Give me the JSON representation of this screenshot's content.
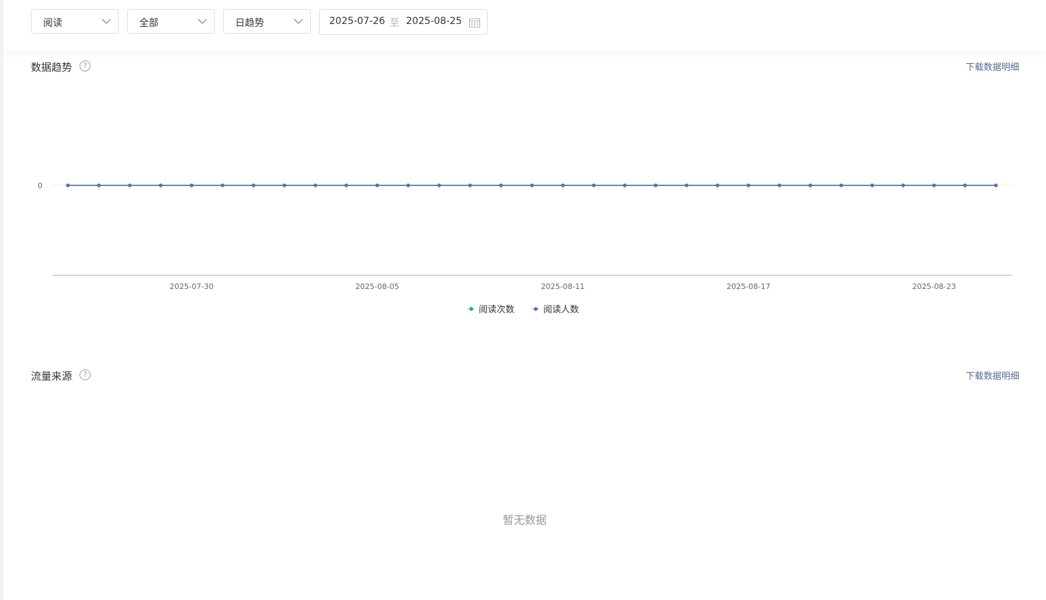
{
  "filters": {
    "type_select": "阅读",
    "scope_select": "全部",
    "period_select": "日趋势",
    "date_start": "2025-07-26",
    "date_sep": "至",
    "date_end": "2025-08-25"
  },
  "trend_section": {
    "title": "数据趋势",
    "help": "?",
    "download": "下载数据明细"
  },
  "source_section": {
    "title": "流量来源",
    "help": "?",
    "download": "下载数据明细",
    "empty_text": "暂无数据"
  },
  "colors": {
    "series_reads": "#19b36b",
    "series_readers": "#5b6bbf",
    "axis": "#d0d0d0",
    "link": "#576b95"
  },
  "chart_data": {
    "type": "line",
    "x": [
      "2025-07-26",
      "2025-07-27",
      "2025-07-28",
      "2025-07-29",
      "2025-07-30",
      "2025-07-31",
      "2025-08-01",
      "2025-08-02",
      "2025-08-03",
      "2025-08-04",
      "2025-08-05",
      "2025-08-06",
      "2025-08-07",
      "2025-08-08",
      "2025-08-09",
      "2025-08-10",
      "2025-08-11",
      "2025-08-12",
      "2025-08-13",
      "2025-08-14",
      "2025-08-15",
      "2025-08-16",
      "2025-08-17",
      "2025-08-18",
      "2025-08-19",
      "2025-08-20",
      "2025-08-21",
      "2025-08-22",
      "2025-08-23",
      "2025-08-24",
      "2025-08-25"
    ],
    "x_tick_labels": [
      "2025-07-30",
      "2025-08-05",
      "2025-08-11",
      "2025-08-17",
      "2025-08-23"
    ],
    "y_tick_labels": [
      "0"
    ],
    "series": [
      {
        "name": "阅读次数",
        "values": [
          0,
          0,
          0,
          0,
          0,
          0,
          0,
          0,
          0,
          0,
          0,
          0,
          0,
          0,
          0,
          0,
          0,
          0,
          0,
          0,
          0,
          0,
          0,
          0,
          0,
          0,
          0,
          0,
          0,
          0,
          0
        ]
      },
      {
        "name": "阅读人数",
        "values": [
          0,
          0,
          0,
          0,
          0,
          0,
          0,
          0,
          0,
          0,
          0,
          0,
          0,
          0,
          0,
          0,
          0,
          0,
          0,
          0,
          0,
          0,
          0,
          0,
          0,
          0,
          0,
          0,
          0,
          0,
          0
        ]
      }
    ],
    "legend_position": "bottom-center",
    "grid": false
  }
}
